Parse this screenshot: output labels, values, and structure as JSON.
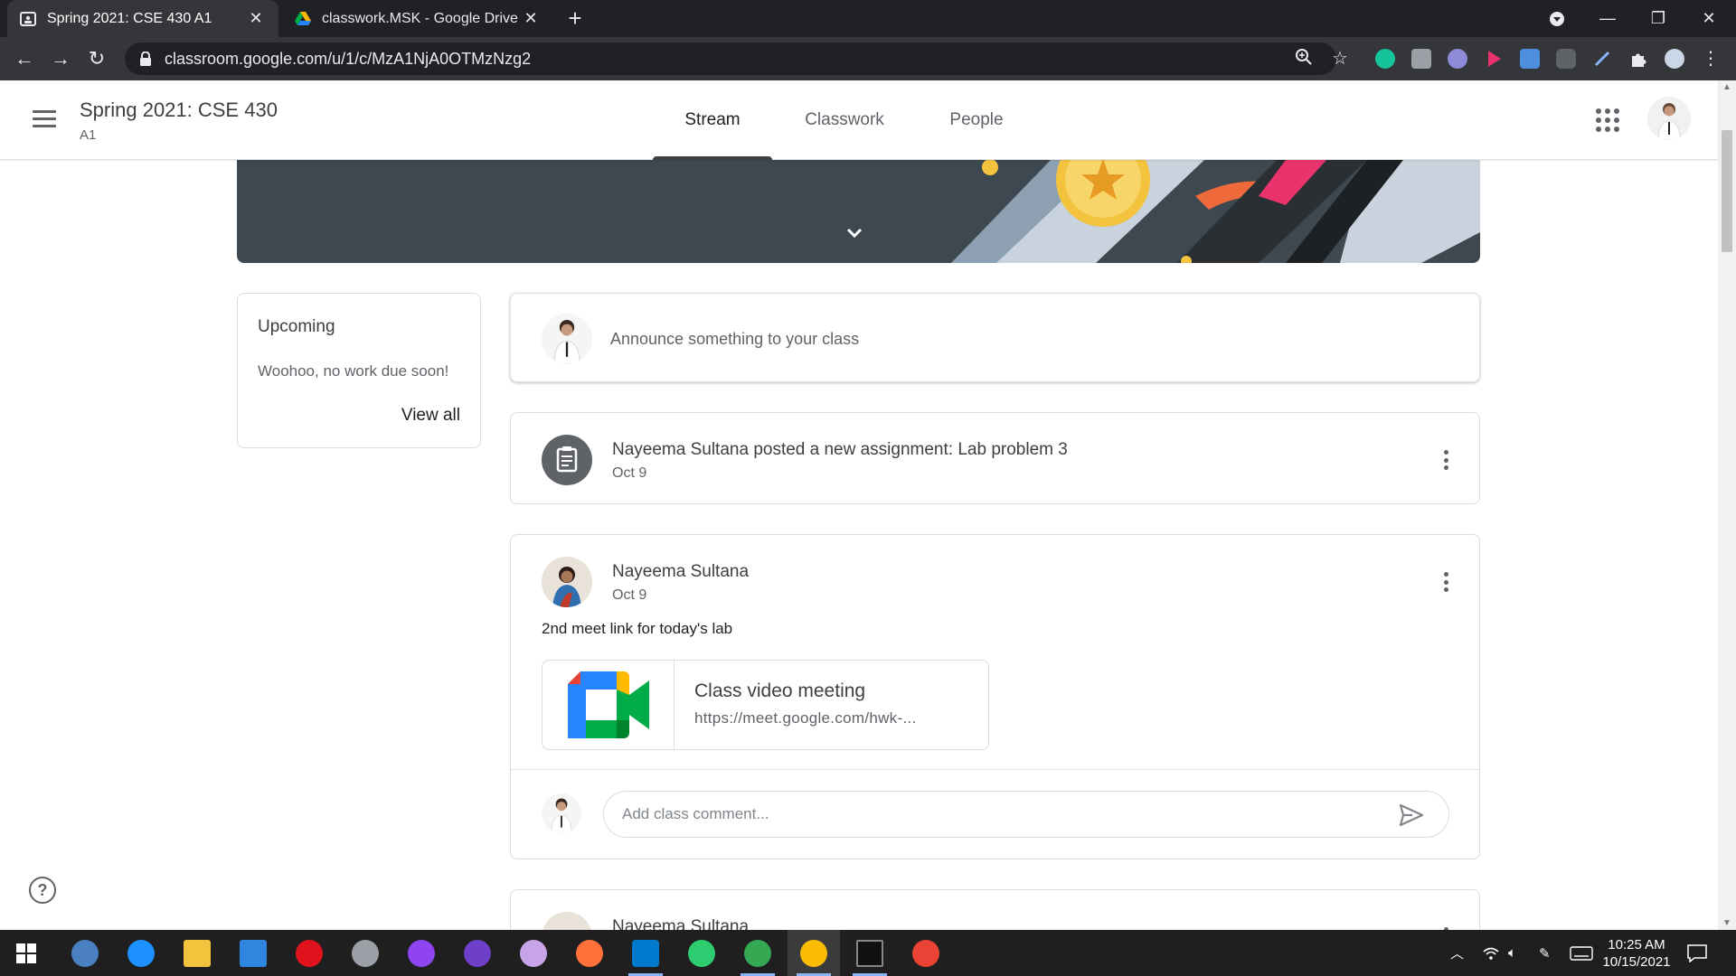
{
  "browser": {
    "tabs": [
      {
        "title": "Spring 2021: CSE 430 A1",
        "active": true
      },
      {
        "title": "classwork.MSK - Google Drive",
        "active": false
      }
    ],
    "url": "classroom.google.com/u/1/c/MzA1NjA0OTMzNzg2"
  },
  "header": {
    "course_title": "Spring 2021: CSE 430",
    "section": "A1",
    "tabs": [
      "Stream",
      "Classwork",
      "People"
    ],
    "active_tab": "Stream"
  },
  "upcoming": {
    "heading": "Upcoming",
    "text": "Woohoo, no work due soon!",
    "view_all": "View all"
  },
  "announce": {
    "placeholder": "Announce something to your class"
  },
  "assignment_post": {
    "title": "Nayeema Sultana posted a new assignment: Lab problem 3",
    "date": "Oct 9"
  },
  "post": {
    "author": "Nayeema Sultana",
    "date": "Oct 9",
    "body": "2nd meet link for today's lab",
    "attachment": {
      "title": "Class video meeting",
      "url": "https://meet.google.com/hwk-..."
    },
    "comment_placeholder": "Add class comment..."
  },
  "next_post": {
    "author": "Nayeema Sultana"
  },
  "taskbar": {
    "time": "10:25 AM",
    "date": "10/15/2021"
  },
  "colors": {
    "tab_underline": "#3c4043",
    "banner": "#3d4850",
    "meet_blue": "#2684fc",
    "meet_green": "#00ac47",
    "meet_yellow": "#ffba00",
    "meet_red": "#ea4335"
  }
}
